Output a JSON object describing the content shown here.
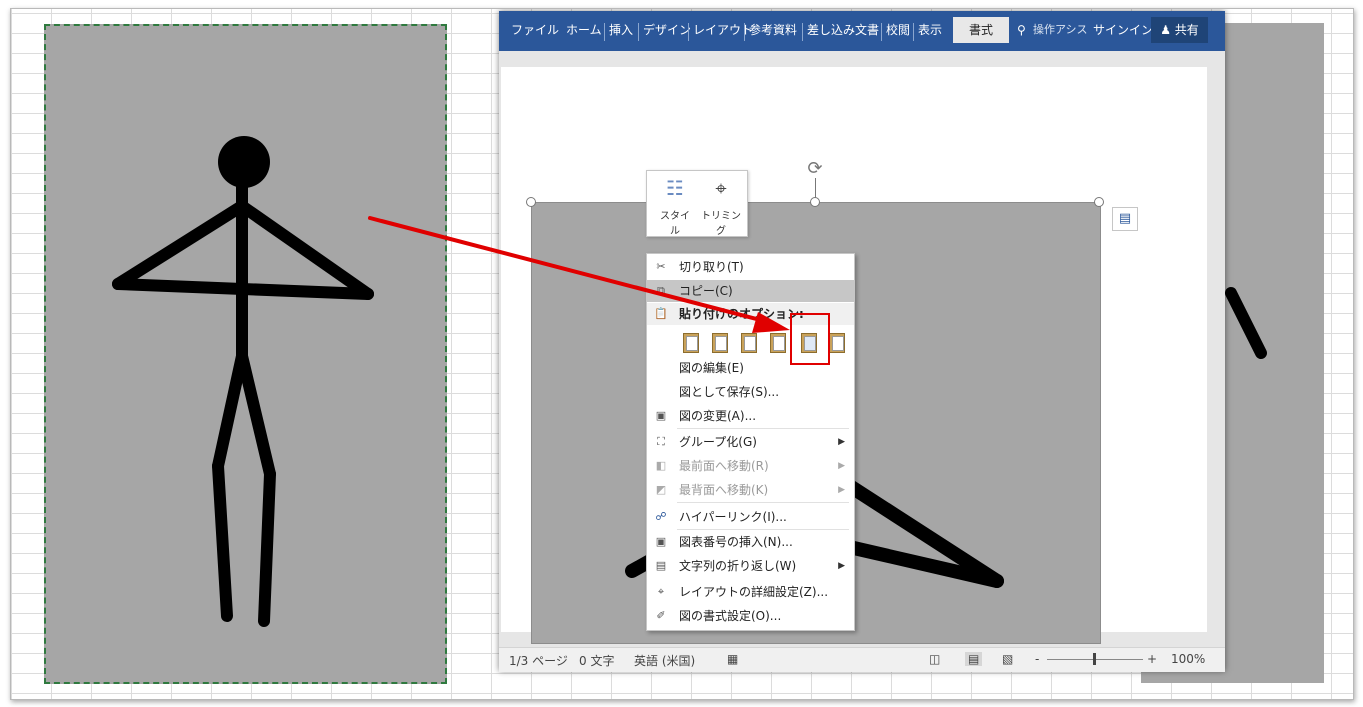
{
  "ribbon": {
    "tabs": [
      "ファイル",
      "ホーム",
      "挿入",
      "デザイン",
      "レイアウト",
      "参考資料",
      "差し込み文書",
      "校閲",
      "表示"
    ],
    "active_tab": "書式",
    "tell_me": "操作アシス",
    "signin": "サインイン",
    "share": "共有"
  },
  "float_toolbar": {
    "style_label": "スタイル",
    "crop_label": "トリミング"
  },
  "context_menu": {
    "cut": "切り取り(T)",
    "copy": "コピー(C)",
    "paste_options": "貼り付けのオプション:",
    "edit_picture": "図の編集(E)",
    "save_as_picture": "図として保存(S)...",
    "change_picture": "図の変更(A)...",
    "group": "グループ化(G)",
    "bring_front": "最前面へ移動(R)",
    "send_back": "最背面へ移動(K)",
    "hyperlink": "ハイパーリンク(I)...",
    "insert_caption": "図表番号の挿入(N)...",
    "wrap_text": "文字列の折り返し(W)",
    "layout_options": "レイアウトの詳細設定(Z)...",
    "format_picture": "図の書式設定(O)..."
  },
  "statusbar": {
    "page": "1/3 ページ",
    "words": "0 文字",
    "language": "英語 (米国)",
    "zoom": "100%",
    "zoom_minus": "-",
    "zoom_plus": "+"
  },
  "colors": {
    "ribbon": "#2b579a",
    "picture_bg": "#a6a6a6",
    "highlight_box": "#e00000",
    "arrow": "#e00000"
  }
}
